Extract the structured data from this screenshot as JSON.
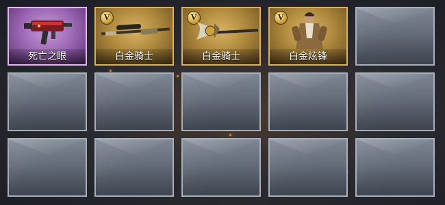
{
  "inventory": {
    "items": [
      {
        "label": "死亡之眼",
        "rarity": "purple",
        "badge": "",
        "icon": "smg-weapon-icon"
      },
      {
        "label": "白金骑士",
        "rarity": "gold",
        "badge": "V",
        "icon": "sniper-rifle-icon"
      },
      {
        "label": "白金骑士",
        "rarity": "gold",
        "badge": "V",
        "icon": "melee-axe-icon"
      },
      {
        "label": "白金炫锋",
        "rarity": "gold",
        "badge": "V",
        "icon": "character-skin-icon"
      }
    ]
  },
  "colors": {
    "gold_border": "#d9b25a",
    "purple_border": "#e7b7f5",
    "empty_border": "#a7afbb"
  }
}
